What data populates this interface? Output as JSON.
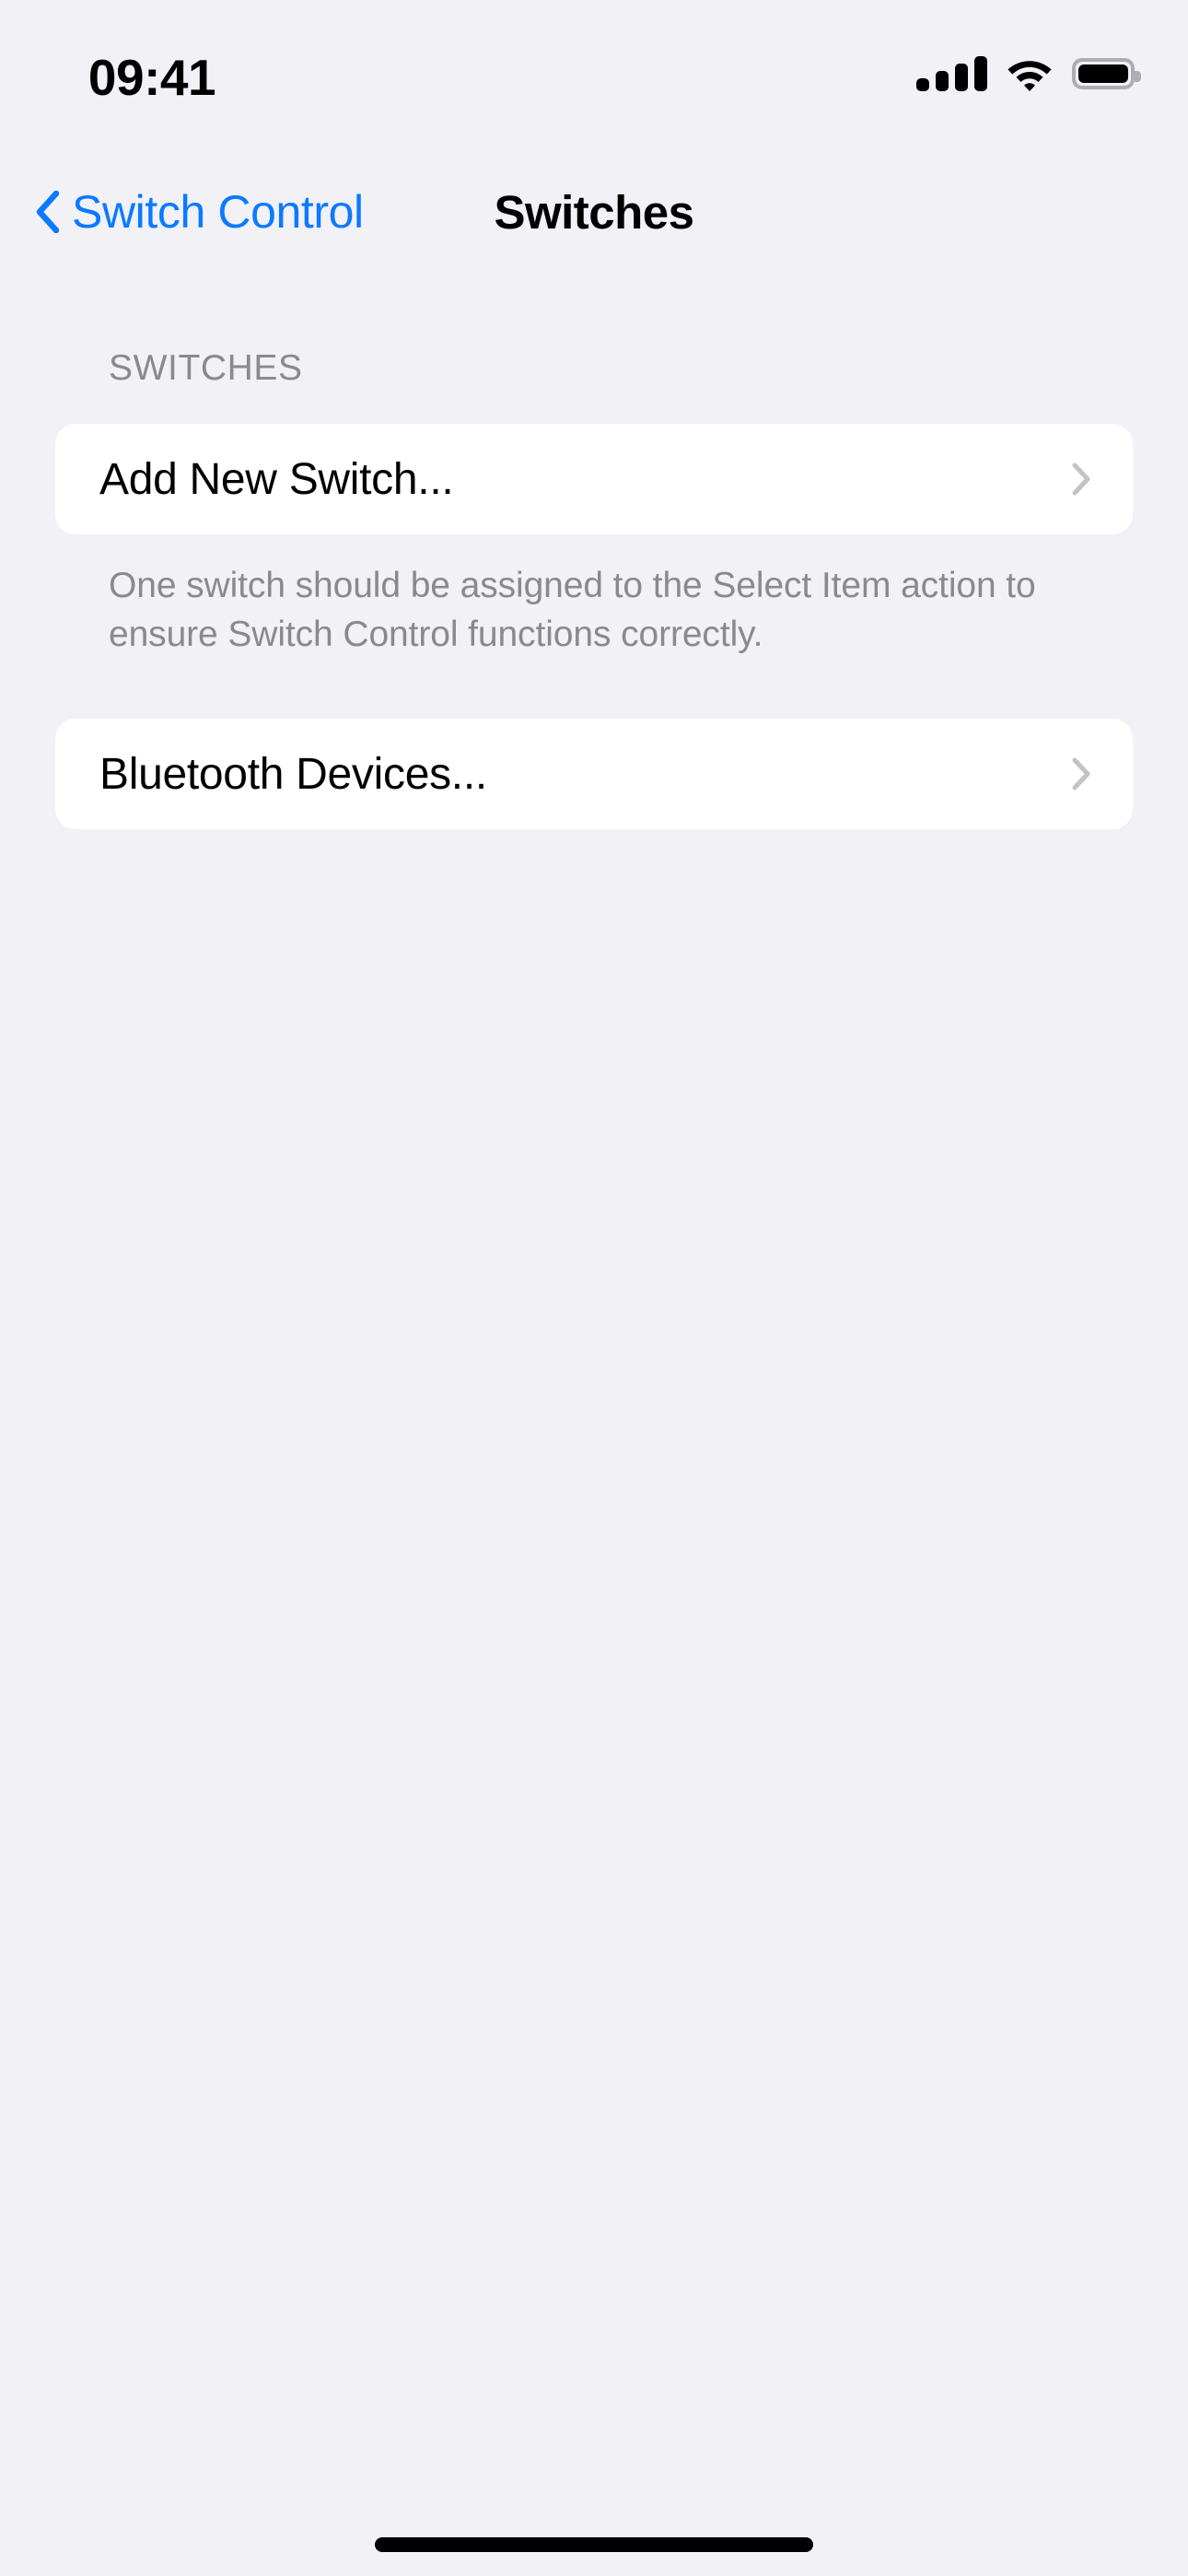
{
  "status_bar": {
    "time": "09:41",
    "cellular_icon": "cellular-signal-icon",
    "cellular_bars": 4,
    "wifi_icon": "wifi-icon",
    "battery_icon": "battery-icon",
    "battery_level_percent": 100
  },
  "nav_bar": {
    "back_icon": "chevron-left-icon",
    "back_label": "Switch Control",
    "title": "Switches"
  },
  "colors": {
    "background": "#f2f1f6",
    "card": "#ffffff",
    "accent_blue": "#0a7aff",
    "secondary_text": "#8a8a8e",
    "chevron_gray": "#c3c3c6",
    "primary_text": "#000000"
  },
  "sections": [
    {
      "header": "SWITCHES",
      "rows": [
        {
          "label": "Add New Switch...",
          "accessory_icon": "chevron-right-icon"
        }
      ],
      "footer": "One switch should be assigned to the Select Item action to ensure Switch Control functions correctly."
    },
    {
      "header": "",
      "rows": [
        {
          "label": "Bluetooth Devices...",
          "accessory_icon": "chevron-right-icon"
        }
      ],
      "footer": ""
    }
  ],
  "home_indicator": "home-indicator"
}
